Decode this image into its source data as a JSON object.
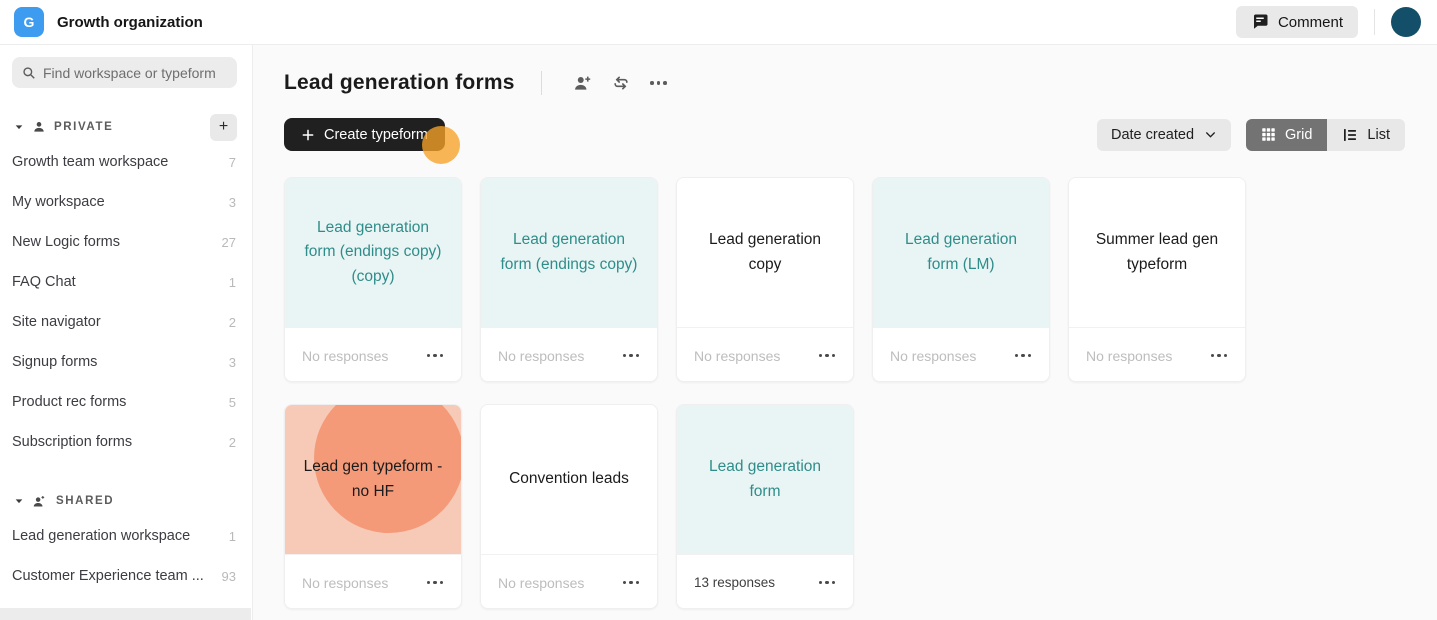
{
  "topbar": {
    "logo_letter": "G",
    "org_name": "Growth organization",
    "comment_label": "Comment"
  },
  "sidebar": {
    "search_placeholder": "Find workspace or typeform",
    "sections": [
      {
        "label": "PRIVATE",
        "icon": "person-icon",
        "add_button": true,
        "items": [
          {
            "label": "Growth team workspace",
            "count": "7"
          },
          {
            "label": "My workspace",
            "count": "3"
          },
          {
            "label": "New Logic forms",
            "count": "27"
          },
          {
            "label": "FAQ Chat",
            "count": "1"
          },
          {
            "label": "Site navigator",
            "count": "2"
          },
          {
            "label": "Signup forms",
            "count": "3"
          },
          {
            "label": "Product rec forms",
            "count": "5"
          },
          {
            "label": "Subscription forms",
            "count": "2"
          }
        ]
      },
      {
        "label": "SHARED",
        "icon": "people-icon",
        "add_button": false,
        "items": [
          {
            "label": "Lead generation workspace",
            "count": "1"
          },
          {
            "label": "Customer Experience team ...",
            "count": "93"
          }
        ]
      }
    ]
  },
  "header": {
    "title": "Lead generation forms"
  },
  "toolbar": {
    "create_label": "Create typeform",
    "sort_label": "Date created",
    "grid_label": "Grid",
    "list_label": "List"
  },
  "cards": [
    {
      "title": "Lead generation form (endings copy) (copy)",
      "theme": "mint",
      "responses": "No responses",
      "responses_emphasis": false
    },
    {
      "title": "Lead generation form (endings copy)",
      "theme": "mint",
      "responses": "No responses",
      "responses_emphasis": false
    },
    {
      "title": "Lead generation copy",
      "theme": "white",
      "responses": "No responses",
      "responses_emphasis": false
    },
    {
      "title": "Lead generation form (LM)",
      "theme": "mint",
      "responses": "No responses",
      "responses_emphasis": false
    },
    {
      "title": "Summer lead gen typeform",
      "theme": "white",
      "responses": "No responses",
      "responses_emphasis": false
    },
    {
      "title": "Lead gen typeform - no HF",
      "theme": "salmon",
      "responses": "No responses",
      "responses_emphasis": false
    },
    {
      "title": "Convention leads",
      "theme": "white",
      "responses": "No responses",
      "responses_emphasis": false
    },
    {
      "title": "Lead generation form",
      "theme": "mint",
      "responses": "13 responses",
      "responses_emphasis": true
    }
  ],
  "colors": {
    "logo_blue": "#3d9bf0",
    "avatar_teal": "#134f68",
    "mint_bg": "#e9f4f5",
    "teal_text": "#2f8d89",
    "salmon_bg": "#f7cab7",
    "salmon_circle": "#f49a79",
    "create_button": "#202020",
    "grid_selected": "#737373",
    "click_indicator": "#f7a228"
  }
}
